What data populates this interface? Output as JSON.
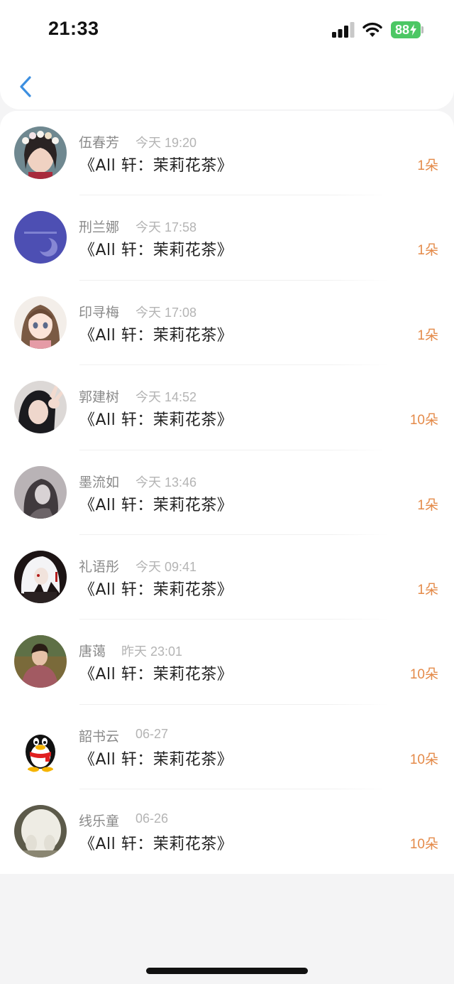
{
  "status_bar": {
    "time": "21:33",
    "battery": "88"
  },
  "items": [
    {
      "name": "伍春芳",
      "date": "今天 19:20",
      "gift": "《All 轩：茉莉花茶》",
      "count": "1朵",
      "avatar": "girl-flower-crown-photo"
    },
    {
      "name": "刑兰娜",
      "date": "今天 17:58",
      "gift": "《All 轩：茉莉花茶》",
      "count": "1朵",
      "avatar": "purple-moon-graphic"
    },
    {
      "name": "印寻梅",
      "date": "今天 17:08",
      "gift": "《All 轩：茉莉花茶》",
      "count": "1朵",
      "avatar": "anime-girl-illustration"
    },
    {
      "name": "郭建树",
      "date": "今天 14:52",
      "gift": "《All 轩：茉莉花茶》",
      "count": "10朵",
      "avatar": "girl-peace-sign-photo"
    },
    {
      "name": "墨流如",
      "date": "今天 13:46",
      "gift": "《All 轩：茉莉花茶》",
      "count": "1朵",
      "avatar": "grey-portrait-photo"
    },
    {
      "name": "礼语彤",
      "date": "今天 09:41",
      "gift": "《All 轩：茉莉花茶》",
      "count": "1朵",
      "avatar": "white-hair-anime-character"
    },
    {
      "name": "唐蔼",
      "date": "昨天 23:01",
      "gift": "《All 轩：茉莉花茶》",
      "count": "10朵",
      "avatar": "man-portrait-photo"
    },
    {
      "name": "韶书云",
      "date": "06-27",
      "gift": "《All 轩：茉莉花茶》",
      "count": "10朵",
      "avatar": "qq-penguin-icon"
    },
    {
      "name": "线乐童",
      "date": "06-26",
      "gift": "《All 轩：茉莉花茶》",
      "count": "10朵",
      "avatar": "white-fluffy-animal-photo"
    }
  ]
}
